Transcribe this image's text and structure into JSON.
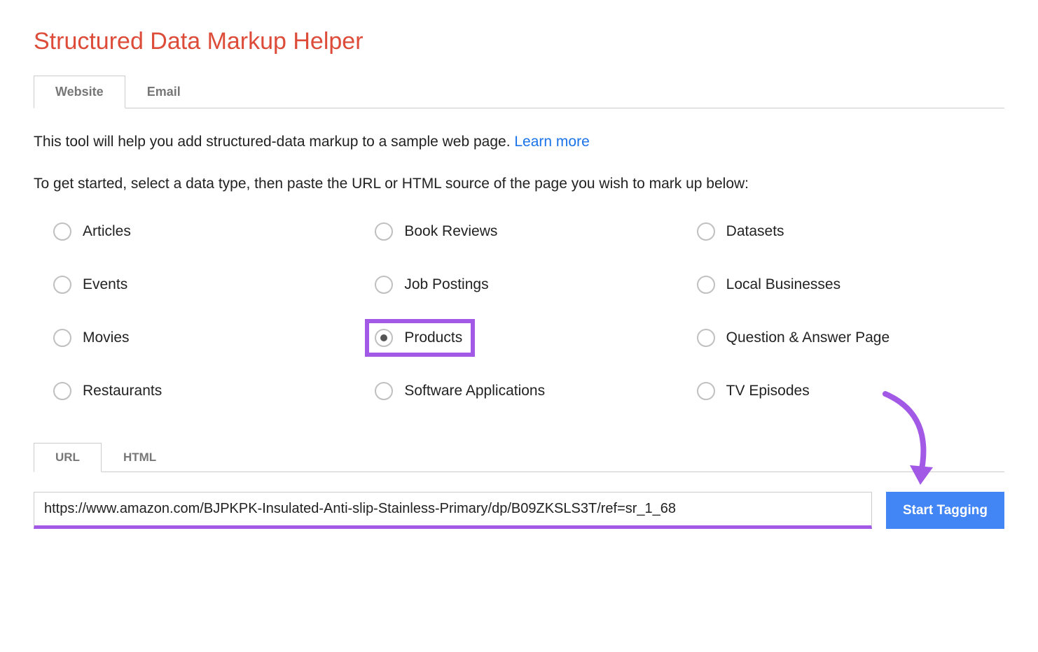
{
  "header": {
    "title": "Structured Data Markup Helper"
  },
  "tabs": {
    "website": "Website",
    "email": "Email",
    "active": "website"
  },
  "intro": {
    "text_before": "This tool will help you add structured-data markup to a sample web page. ",
    "learn_more": "Learn more"
  },
  "instruction": "To get started, select a data type, then paste the URL or HTML source of the page you wish to mark up below:",
  "data_types": [
    {
      "id": "articles",
      "label": "Articles",
      "selected": false
    },
    {
      "id": "book-reviews",
      "label": "Book Reviews",
      "selected": false
    },
    {
      "id": "datasets",
      "label": "Datasets",
      "selected": false
    },
    {
      "id": "events",
      "label": "Events",
      "selected": false
    },
    {
      "id": "job-postings",
      "label": "Job Postings",
      "selected": false
    },
    {
      "id": "local-businesses",
      "label": "Local Businesses",
      "selected": false
    },
    {
      "id": "movies",
      "label": "Movies",
      "selected": false
    },
    {
      "id": "products",
      "label": "Products",
      "selected": true,
      "highlighted": true
    },
    {
      "id": "qa-page",
      "label": "Question & Answer Page",
      "selected": false
    },
    {
      "id": "restaurants",
      "label": "Restaurants",
      "selected": false
    },
    {
      "id": "software-applications",
      "label": "Software Applications",
      "selected": false
    },
    {
      "id": "tv-episodes",
      "label": "TV Episodes",
      "selected": false
    }
  ],
  "input_tabs": {
    "url": "URL",
    "html": "HTML",
    "active": "url"
  },
  "url_input": {
    "value": "https://www.amazon.com/BJPKPK-Insulated-Anti-slip-Stainless-Primary/dp/B09ZKSLS3T/ref=sr_1_68"
  },
  "buttons": {
    "start_tagging": "Start Tagging"
  },
  "colors": {
    "title": "#dd4b39",
    "link": "#1a73e8",
    "primary_button": "#4285f4",
    "highlight": "#a259e6"
  }
}
